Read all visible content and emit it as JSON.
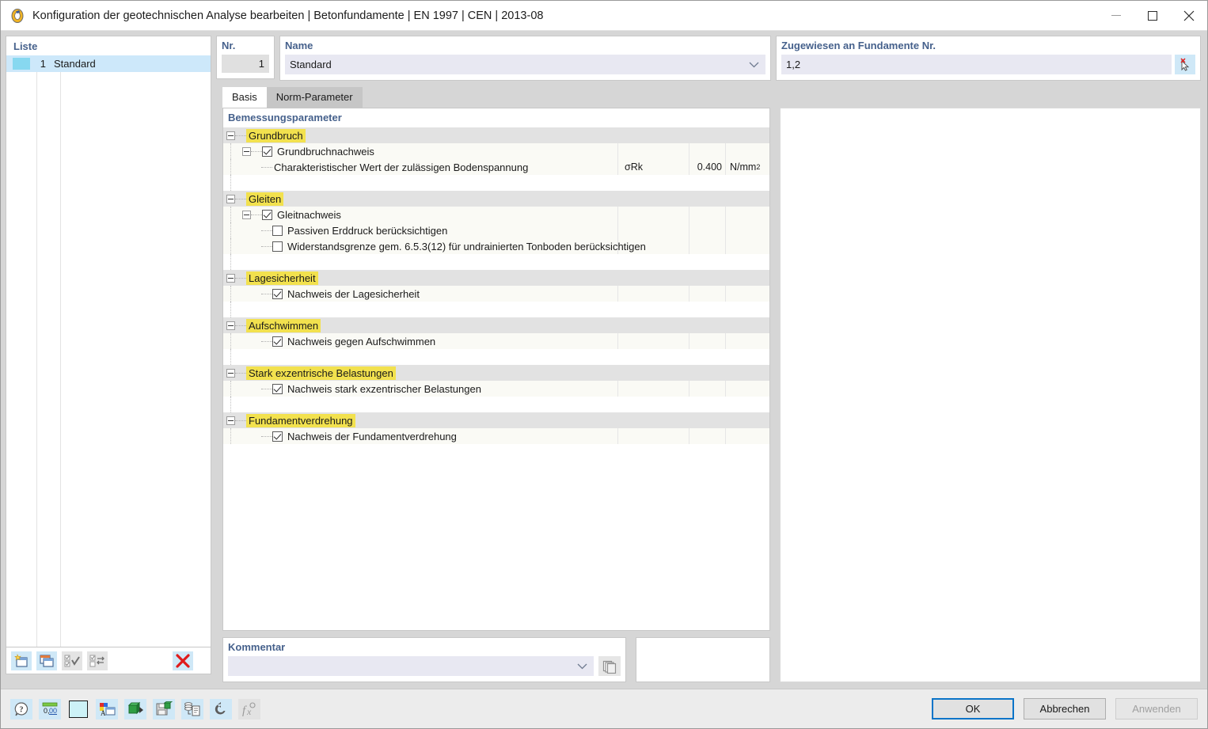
{
  "window": {
    "title": "Konfiguration der geotechnischen Analyse bearbeiten | Betonfundamente | EN 1997 | CEN | 2013-08",
    "app_icon": "dlubal-app-icon",
    "minimize_label": "─",
    "maximize_label": "□",
    "close_label": "✕"
  },
  "list_panel": {
    "header": "Liste",
    "rows": [
      {
        "color": "#87d8f0",
        "no": "1",
        "name": "Standard"
      }
    ],
    "toolbar": [
      {
        "name": "new-entry-button",
        "icon": "new-window-star-icon",
        "enabled": true
      },
      {
        "name": "duplicate-entry-button",
        "icon": "copy-window-icon",
        "enabled": true
      },
      {
        "name": "select-all-button",
        "icon": "check-all-icon",
        "enabled": false
      },
      {
        "name": "invert-selection-button",
        "icon": "invert-selection-icon",
        "enabled": false
      },
      {
        "name": "delete-entry-button",
        "icon": "red-x-icon",
        "enabled": true
      }
    ]
  },
  "header_fields": {
    "nr": {
      "label": "Nr.",
      "value": "1"
    },
    "name": {
      "label": "Name",
      "value": "Standard",
      "chevron": "⌄"
    },
    "assigned": {
      "label": "Zugewiesen an Fundamente Nr.",
      "value": "1,2",
      "pick_icon": "select-objects-cursor-icon"
    }
  },
  "tabs": [
    {
      "label": "Basis",
      "active": true
    },
    {
      "label": "Norm-Parameter",
      "active": false
    }
  ],
  "tree": {
    "title": "Bemessungsparameter",
    "groups": [
      {
        "label": "Grundbruch",
        "rows": [
          {
            "kind": "check",
            "indent": 1,
            "expander": true,
            "checked": true,
            "label": "Grundbruchnachweis",
            "symbol": "",
            "value": "",
            "unit": ""
          },
          {
            "kind": "value",
            "indent": 2,
            "expander": false,
            "label": "Charakteristischer Wert der zulässigen Bodenspannung",
            "symbol": "σRk",
            "value": "0.400",
            "unit": "N/mm",
            "unit_sup": "2"
          }
        ]
      },
      {
        "label": "Gleiten",
        "rows": [
          {
            "kind": "check",
            "indent": 1,
            "expander": true,
            "checked": true,
            "label": "Gleitnachweis",
            "symbol": "",
            "value": "",
            "unit": ""
          },
          {
            "kind": "check",
            "indent": 2,
            "expander": false,
            "checked": false,
            "label": "Passiven Erddruck berücksichtigen",
            "symbol": "",
            "value": "",
            "unit": ""
          },
          {
            "kind": "check",
            "indent": 2,
            "expander": false,
            "checked": false,
            "label": "Widerstandsgrenze gem. 6.5.3(12) für undrainierten Tonboden berücksichtigen",
            "symbol": "",
            "value": "",
            "unit": ""
          }
        ]
      },
      {
        "label": "Lagesicherheit",
        "rows": [
          {
            "kind": "check",
            "indent": 2,
            "expander": false,
            "checked": true,
            "label": "Nachweis der Lagesicherheit",
            "symbol": "",
            "value": "",
            "unit": ""
          }
        ]
      },
      {
        "label": "Aufschwimmen",
        "rows": [
          {
            "kind": "check",
            "indent": 2,
            "expander": false,
            "checked": true,
            "label": "Nachweis gegen Aufschwimmen",
            "symbol": "",
            "value": "",
            "unit": ""
          }
        ]
      },
      {
        "label": "Stark exzentrische Belastungen",
        "rows": [
          {
            "kind": "check",
            "indent": 2,
            "expander": false,
            "checked": true,
            "label": "Nachweis stark exzentrischer Belastungen",
            "symbol": "",
            "value": "",
            "unit": ""
          }
        ]
      },
      {
        "label": "Fundamentverdrehung",
        "rows": [
          {
            "kind": "check",
            "indent": 2,
            "expander": false,
            "checked": true,
            "label": "Nachweis der Fundamentverdrehung",
            "symbol": "",
            "value": "",
            "unit": ""
          }
        ]
      }
    ]
  },
  "comment": {
    "label": "Kommentar",
    "value": "",
    "chevron": "⌄",
    "copy_icon": "copy-pages-icon"
  },
  "bottom_toolbar": [
    {
      "name": "help-button",
      "icon": "help-question-icon",
      "enabled": true
    },
    {
      "name": "units-decimal-places-button",
      "icon": "number-format-icon",
      "enabled": true
    },
    {
      "name": "color-swatch-button",
      "icon": "color-swatch-icon",
      "enabled": true,
      "color": "#cdf2f7"
    },
    {
      "name": "display-properties-button",
      "icon": "display-properties-icon",
      "enabled": true
    },
    {
      "name": "import-button",
      "icon": "import-green-arrow-icon",
      "enabled": true
    },
    {
      "name": "save-button",
      "icon": "save-floppy-green-icon",
      "enabled": true
    },
    {
      "name": "report-button",
      "icon": "report-document-icon",
      "enabled": true
    },
    {
      "name": "reset-button",
      "icon": "undo-reset-icon",
      "enabled": true
    },
    {
      "name": "formula-button",
      "icon": "formula-fx-icon",
      "enabled": false
    }
  ],
  "dialog_buttons": {
    "ok": "OK",
    "cancel": "Abbrechen",
    "apply": "Anwenden",
    "apply_enabled": false
  },
  "colors": {
    "accent_blue": "#46618c",
    "highlight_yellow": "#f2e14e",
    "selection_blue": "#cde8fa",
    "toolbar_button": "#cfe8f7",
    "focus_border": "#0a74c8"
  }
}
